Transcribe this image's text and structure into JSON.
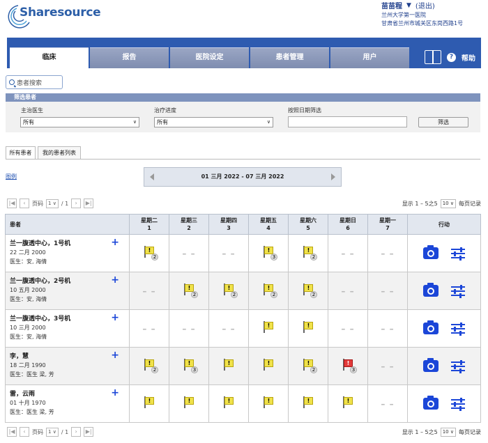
{
  "app": {
    "logo_text": "Sharesource"
  },
  "user": {
    "name": "苗苗程",
    "logout": "(退出)",
    "hospital": "兰州大学第一医院",
    "address": "甘肃省兰州市城关区东岗西路1号"
  },
  "nav": {
    "tabs": [
      "临床",
      "报告",
      "医院设定",
      "患者管理",
      "用户"
    ],
    "help": "帮助"
  },
  "search": {
    "placeholder": "患者搜索"
  },
  "filter": {
    "title": "筛选患者",
    "doctor_label": "主治医生",
    "doctor_value": "所有",
    "progress_label": "治疗进度",
    "progress_value": "所有",
    "date_label": "按照日期筛选",
    "date_value": "",
    "button": "筛选"
  },
  "subtabs": [
    "所有患者",
    "我的患者列表"
  ],
  "legend": "图例",
  "date_range": "01 三月 2022 - 07 三月 2022",
  "pager": {
    "page_label": "页码",
    "page": "1",
    "of": "/ 1",
    "display": "显示 1 – 5之5",
    "per_page": "10",
    "per_page_label": "每页记录"
  },
  "table": {
    "patient_header": "患者",
    "action_header": "行动",
    "days": [
      {
        "name": "星期二",
        "num": "1"
      },
      {
        "name": "星期三",
        "num": "2"
      },
      {
        "name": "星期四",
        "num": "3"
      },
      {
        "name": "星期五",
        "num": "4"
      },
      {
        "name": "星期六",
        "num": "5"
      },
      {
        "name": "星期日",
        "num": "6"
      },
      {
        "name": "星期一",
        "num": "7"
      }
    ],
    "dash": "– –",
    "rows": [
      {
        "name": "兰一腹透中心，1号机",
        "dob": "22 二月 2000",
        "doctor": "医生：安, 海倩",
        "cells": [
          {
            "t": "flag",
            "c": "2"
          },
          {
            "t": "dash"
          },
          {
            "t": "dash"
          },
          {
            "t": "flag",
            "c": "3"
          },
          {
            "t": "flag",
            "c": "2"
          },
          {
            "t": "dash"
          },
          {
            "t": "dash"
          }
        ]
      },
      {
        "name": "兰一腹透中心，2号机",
        "dob": "10 五月 2000",
        "doctor": "医生：安, 海倩",
        "cells": [
          {
            "t": "dash"
          },
          {
            "t": "flag",
            "c": "2"
          },
          {
            "t": "flag",
            "c": "2"
          },
          {
            "t": "flag",
            "c": "2"
          },
          {
            "t": "flag",
            "c": "2"
          },
          {
            "t": "dash"
          },
          {
            "t": "dash"
          }
        ]
      },
      {
        "name": "兰一腹透中心，3号机",
        "dob": "10 三月 2000",
        "doctor": "医生：安, 海倩",
        "cells": [
          {
            "t": "dash"
          },
          {
            "t": "dash"
          },
          {
            "t": "dash"
          },
          {
            "t": "flag",
            "c": ""
          },
          {
            "t": "flag",
            "c": ""
          },
          {
            "t": "dash"
          },
          {
            "t": "dash"
          }
        ]
      },
      {
        "name": "李，慧",
        "dob": "18 二月 1990",
        "doctor": "医生：医生 梁, 芳",
        "cells": [
          {
            "t": "flag",
            "c": "2"
          },
          {
            "t": "flag",
            "c": "3"
          },
          {
            "t": "flag",
            "c": ""
          },
          {
            "t": "flag",
            "c": ""
          },
          {
            "t": "flag",
            "c": "2"
          },
          {
            "t": "redflag",
            "c": "3"
          },
          {
            "t": "dash"
          }
        ]
      },
      {
        "name": "雷，云雨",
        "dob": "01 十月 1970",
        "doctor": "医生：医生 梁, 芳",
        "cells": [
          {
            "t": "flag",
            "c": ""
          },
          {
            "t": "flag",
            "c": ""
          },
          {
            "t": "flag",
            "c": ""
          },
          {
            "t": "flag",
            "c": ""
          },
          {
            "t": "flag",
            "c": ""
          },
          {
            "t": "flag",
            "c": ""
          },
          {
            "t": "dash"
          }
        ]
      }
    ]
  },
  "colors": {
    "nav": "#2e5bb0",
    "action_icons": "#1b46d8",
    "flag": "#f0e24a",
    "alert_flag": "#e23a3a"
  }
}
